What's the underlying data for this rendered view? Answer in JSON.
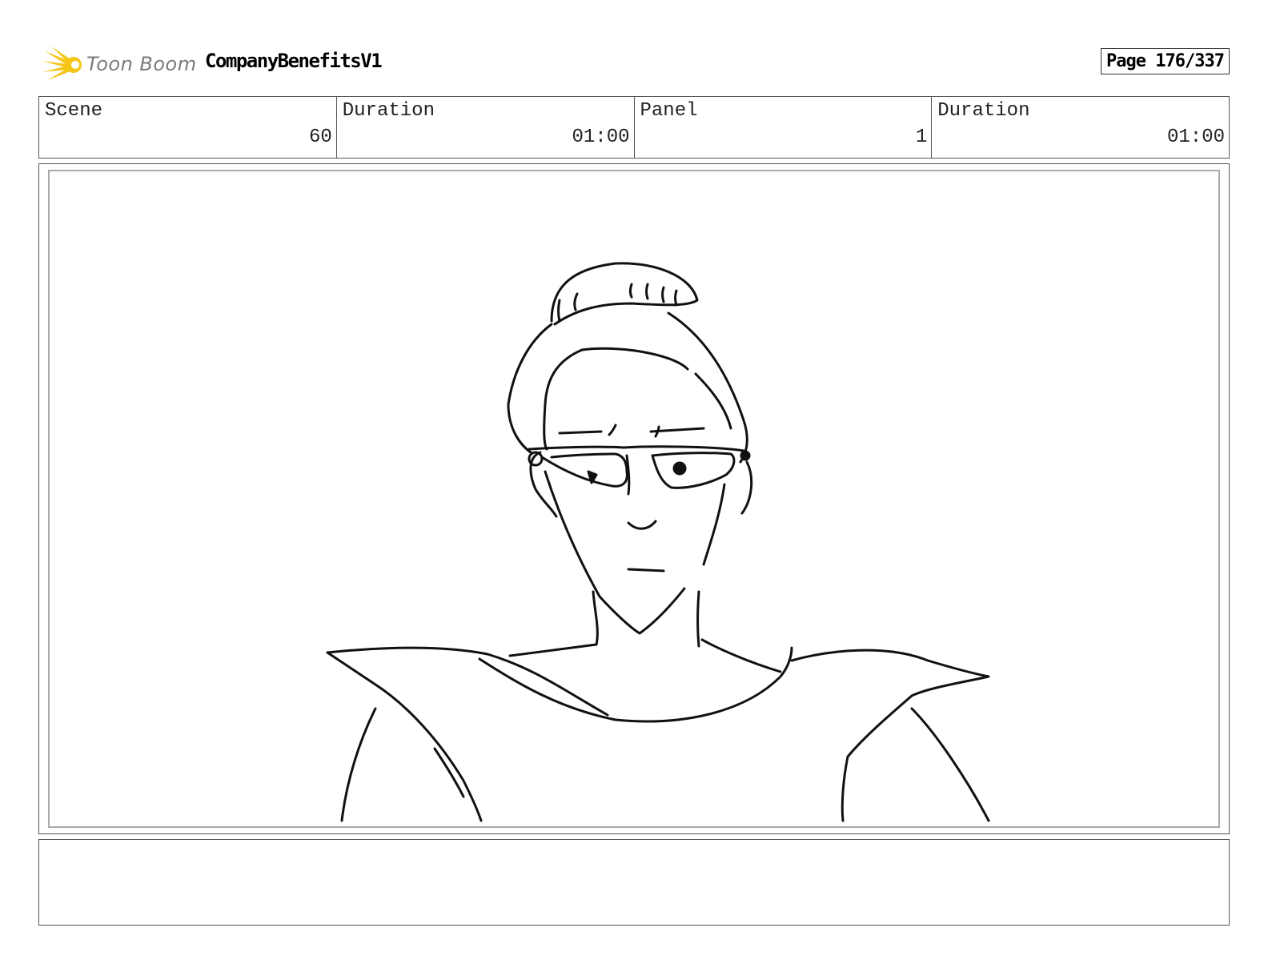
{
  "header": {
    "logo_text": "Toon Boom",
    "project_title": "CompanyBenefitsV1",
    "page_label": "Page 176/337"
  },
  "info": {
    "scene": {
      "label": "Scene",
      "value": "60"
    },
    "scene_duration": {
      "label": "Duration",
      "value": "01:00"
    },
    "panel": {
      "label": "Panel",
      "value": "1"
    },
    "panel_duration": {
      "label": "Duration",
      "value": "01:00"
    }
  },
  "notes": {
    "text": ""
  },
  "colors": {
    "logo_accent": "#f5c518",
    "logo_text": "#7a7a7a",
    "border": "#555555"
  },
  "icons": {
    "logo": "toon-boom-starburst-icon"
  }
}
